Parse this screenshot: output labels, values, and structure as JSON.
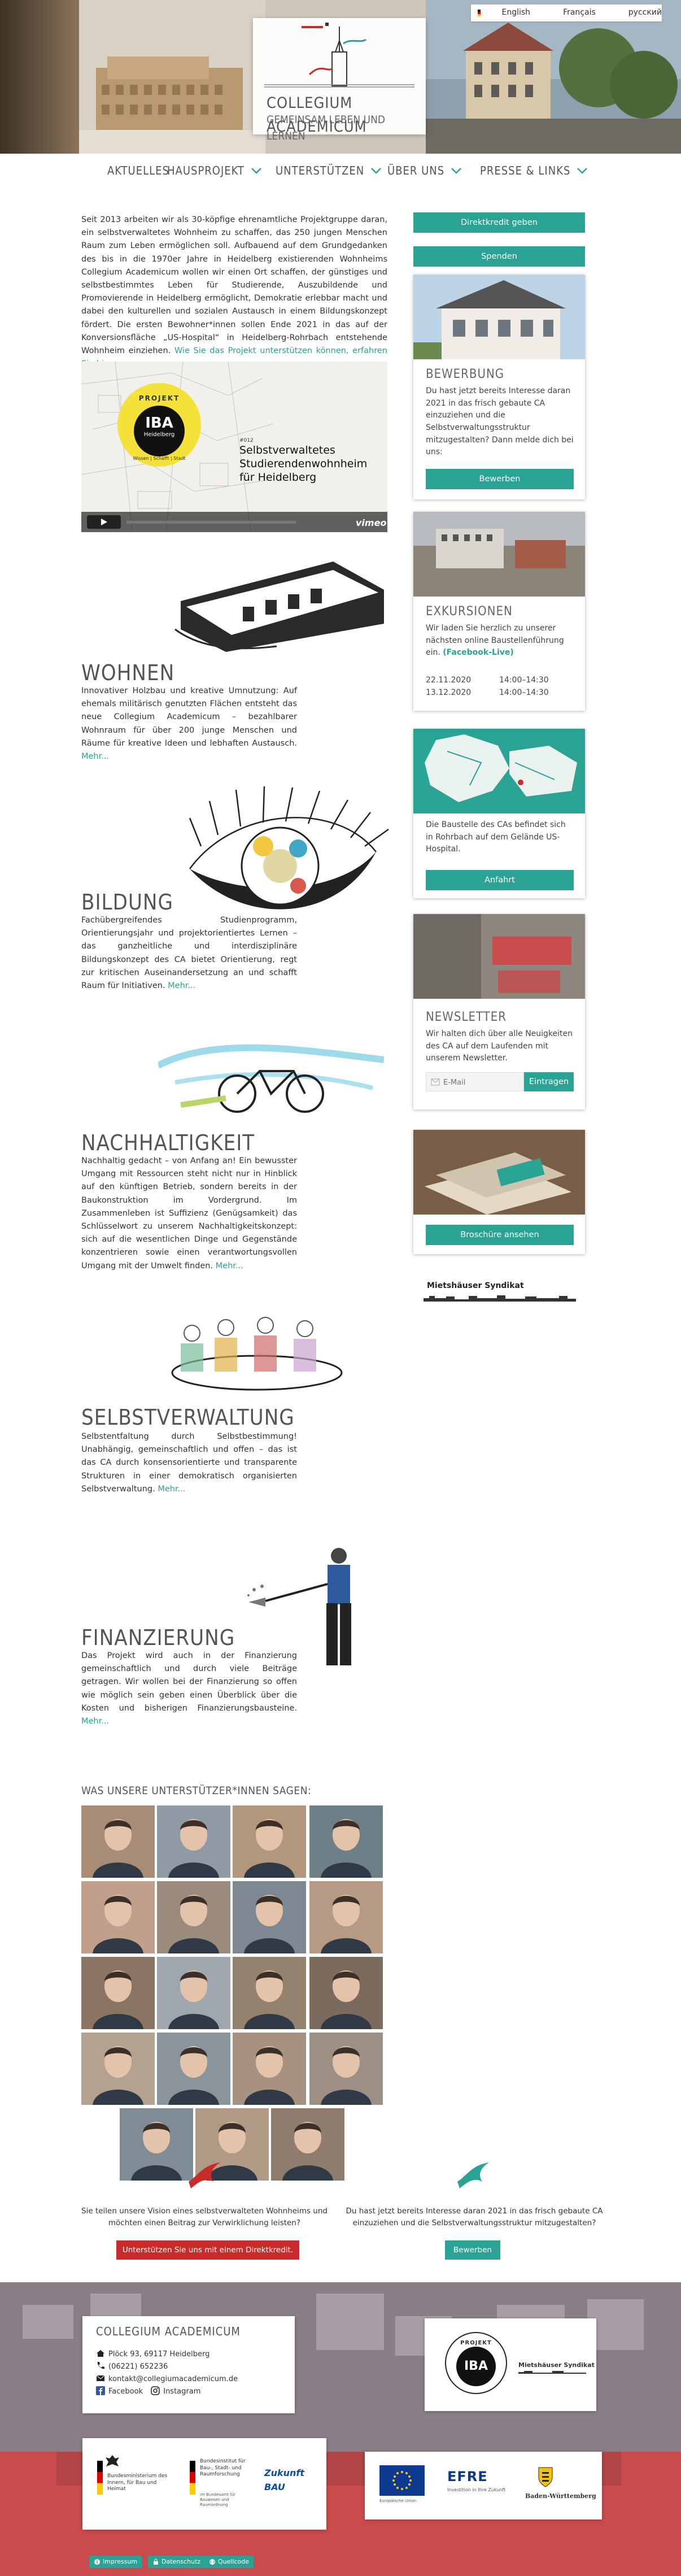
{
  "header": {
    "logo_line1": "COLLEGIUM ACADEMICUM",
    "logo_line2": "GEMEINSAM LEBEN UND LERNEN",
    "languages": [
      "English",
      "Français",
      "русский"
    ]
  },
  "nav": {
    "items": [
      {
        "label": "AKTUELLES",
        "dropdown": false
      },
      {
        "label": "HAUSPROJEKT",
        "dropdown": true
      },
      {
        "label": "UNTERSTÜTZEN",
        "dropdown": true
      },
      {
        "label": "ÜBER UNS",
        "dropdown": true
      },
      {
        "label": "PRESSE & LINKS",
        "dropdown": true
      }
    ]
  },
  "intro": {
    "text": "Seit 2013 arbeiten wir als 30-köpfige ehrenamtliche Projektgruppe daran, ein selbstverwaltetes Wohnheim zu schaffen, das 250 jungen Menschen Raum zum Leben ermöglichen soll. Aufbauend auf dem Grundgedanken des bis in die 1970er Jahre in Heidelberg existierenden Wohnheims Collegium Academicum wollen wir einen Ort schaffen, der günstiges und selbstbestimmtes Leben für Studierende, Auszubildende und Promovierende in Heidelberg ermöglicht, Demokratie erlebbar macht und dabei den kulturellen und sozialen Austausch in einem Bildungskonzept fördert. Die ersten Bewohner*innen sollen Ende 2021 in das auf der Konversionsfläche „US-Hospital“ in Heidelberg-Rohrbach entstehende Wohnheim einziehen.",
    "link": "Wie Sie das Projekt unterstützen können, erfahren Sie hier."
  },
  "video": {
    "badge_top": "PROJEKT",
    "badge_mid": "IBA",
    "badge_city": "Heidelberg",
    "badge_bottom": "Wissen | Schafft | Stadt",
    "title_small": "#012",
    "title_line1": "Selbstverwaltetes",
    "title_line2": "Studierendenwohnheim",
    "title_line3": "für Heidelberg",
    "player": "vimeo"
  },
  "sections": [
    {
      "title": "WOHNEN",
      "text": "Innovativer Holzbau und kreative Umnutzung: Auf ehemals militärisch genutzten Flächen entsteht das neue Collegium Academicum – bezahlbarer Wohnraum für über 200 junge Menschen und Räume für kreative Ideen und lebhaften Austausch.",
      "more": "Mehr..."
    },
    {
      "title": "BILDUNG",
      "text": "Fachübergreifendes Studienprogramm, Orientierungsjahr und projektorientiertes Lernen – das ganzheitliche und interdisziplinäre Bildungskonzept des CA bietet Orientierung, regt zur kritischen Auseinandersetzung an und schafft Raum für Initiativen.",
      "more": "Mehr..."
    },
    {
      "title": "NACHHALTIGKEIT",
      "text": "Nachhaltig gedacht – von Anfang an! Ein bewusster Umgang mit Ressourcen steht nicht nur in Hinblick auf den künftigen Betrieb, sondern bereits in der Baukonstruktion im Vordergrund. Im Zusammenleben ist Suffizienz (Genügsamkeit) das Schlüsselwort zu unserem Nachhaltigkeitskonzept: sich auf die wesentlichen Dinge und Gegenstände konzentrieren sowie einen verantwortungsvollen Umgang mit der Umwelt finden.",
      "more": "Mehr..."
    },
    {
      "title": "SELBSTVERWALTUNG",
      "text": "Selbstentfaltung durch Selbstbestimmung! Unabhängig, gemeinschaftlich und offen – das ist das CA durch konsensorientierte und transparente Strukturen in einer demokratisch organisierten Selbstverwaltung.",
      "more": "Mehr..."
    },
    {
      "title": "FINANZIERUNG",
      "text": "Das Projekt wird auch in der Finanzierung gemeinschaftlich und durch viele Beiträge getragen. Wir wollen bei der Finanzierung so offen wie möglich sein geben einen Überblick über die Kosten und bisherigen Finanzierungsbausteine.",
      "more": "Mehr..."
    }
  ],
  "supporters": {
    "title": "WAS UNSERE UNTERSTÜTZER*INNEN SAGEN:",
    "count": 19
  },
  "sidebar": {
    "btn_direktkredit": "Direktkredit geben",
    "btn_spenden": "Spenden",
    "bewerbung": {
      "title": "BEWERBUNG",
      "text": "Du hast jetzt bereits Interesse daran 2021 in das frisch gebaute CA einzuziehen und die Selbstverwaltungsstruktur mitzugestalten? Dann melde dich bei uns:",
      "button": "Bewerben"
    },
    "exkursionen": {
      "title": "EXKURSIONEN",
      "text": "Wir laden Sie herzlich zu unserer nächsten online Baustellenführung ein.",
      "link": "(Facebook-Live)",
      "rows": [
        {
          "date": "22.11.2020",
          "time": "14:00–14:30"
        },
        {
          "date": "13.12.2020",
          "time": "14:00–14:30"
        }
      ]
    },
    "anfahrt": {
      "text": "Die Baustelle des CAs befindet sich in Rohrbach auf dem Gelände US-Hospital.",
      "button": "Anfahrt"
    },
    "newsletter": {
      "title": "NEWSLETTER",
      "text": "Wir halten dich über alle Neuigkeiten des CA auf dem Laufenden mit unserem Newsletter.",
      "placeholder": "E-Mail",
      "button": "Eintragen"
    },
    "broschuere": {
      "button": "Broschüre ansehen"
    },
    "syndikat": "Mietshäuser Syndikat"
  },
  "cta": {
    "left_text": "Sie teilen unsere Vision eines selbstverwalteten Wohnheims und möchten einen Beitrag zur Verwirklichung leisten?",
    "left_button": "Unterstützen Sie uns mit einem Direktkredit.",
    "right_text": "Du hast jetzt bereits Interesse daran 2021 in das frisch gebaute CA einzuziehen und die Selbstverwaltungsstruktur mitzugestalten?",
    "right_button": "Bewerben"
  },
  "footer": {
    "org": "COLLEGIUM ACADEMICUM",
    "address": "Plöck 93, 69117 Heidelberg",
    "phone": "(06221) 652236",
    "email": "kontakt@collegiumacademicum.de",
    "facebook": "Facebook",
    "instagram": "Instagram",
    "iba_top": "PROJEKT",
    "iba_mid": "IBA",
    "syndikat": "Mietshäuser Syndikat",
    "bmi": "Bundesministerium des Innern, für Bau und Heimat",
    "bbsr": "Bundesinstitut für Bau-, Stadt- und Raumforschung",
    "bbsr_sub": "im Bundesamt für Bauwesen und Raumordnung",
    "zukunft_bau": "Zukunft BAU",
    "eu": "Europäische Union",
    "efre": "EFRE",
    "efre_sub": "Investition in Ihre Zukunft",
    "bw": "Baden-Württemberg",
    "links": [
      "Impressum",
      "Datenschutz",
      "Quellcode"
    ]
  },
  "colors": {
    "accent": "#2aa394",
    "red": "#c92a2a",
    "footer_band": "#c94b4b"
  }
}
